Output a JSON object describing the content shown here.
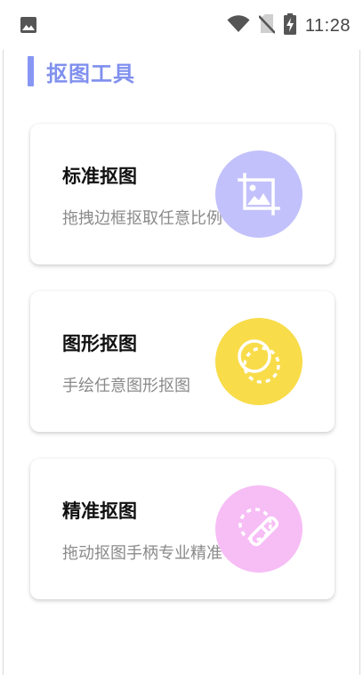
{
  "status_bar": {
    "time": "11:28",
    "icons": [
      "image-icon",
      "wifi-icon",
      "no-sim-icon",
      "battery-charging-icon"
    ]
  },
  "page": {
    "title": "抠图工具",
    "accent_color": "#8797f3"
  },
  "cards": [
    {
      "title": "标准抠图",
      "description": "拖拽边框抠取任意比例",
      "icon": "crop-image-icon",
      "circle_color": "#c3c1fb"
    },
    {
      "title": "图形抠图",
      "description": "手绘任意图形抠图",
      "icon": "circle-shape-icon",
      "circle_color": "#f8dc4a"
    },
    {
      "title": "精准抠图",
      "description": "拖动抠图手柄专业精准",
      "icon": "precise-cutout-icon",
      "circle_color": "#f7bdf5"
    }
  ]
}
